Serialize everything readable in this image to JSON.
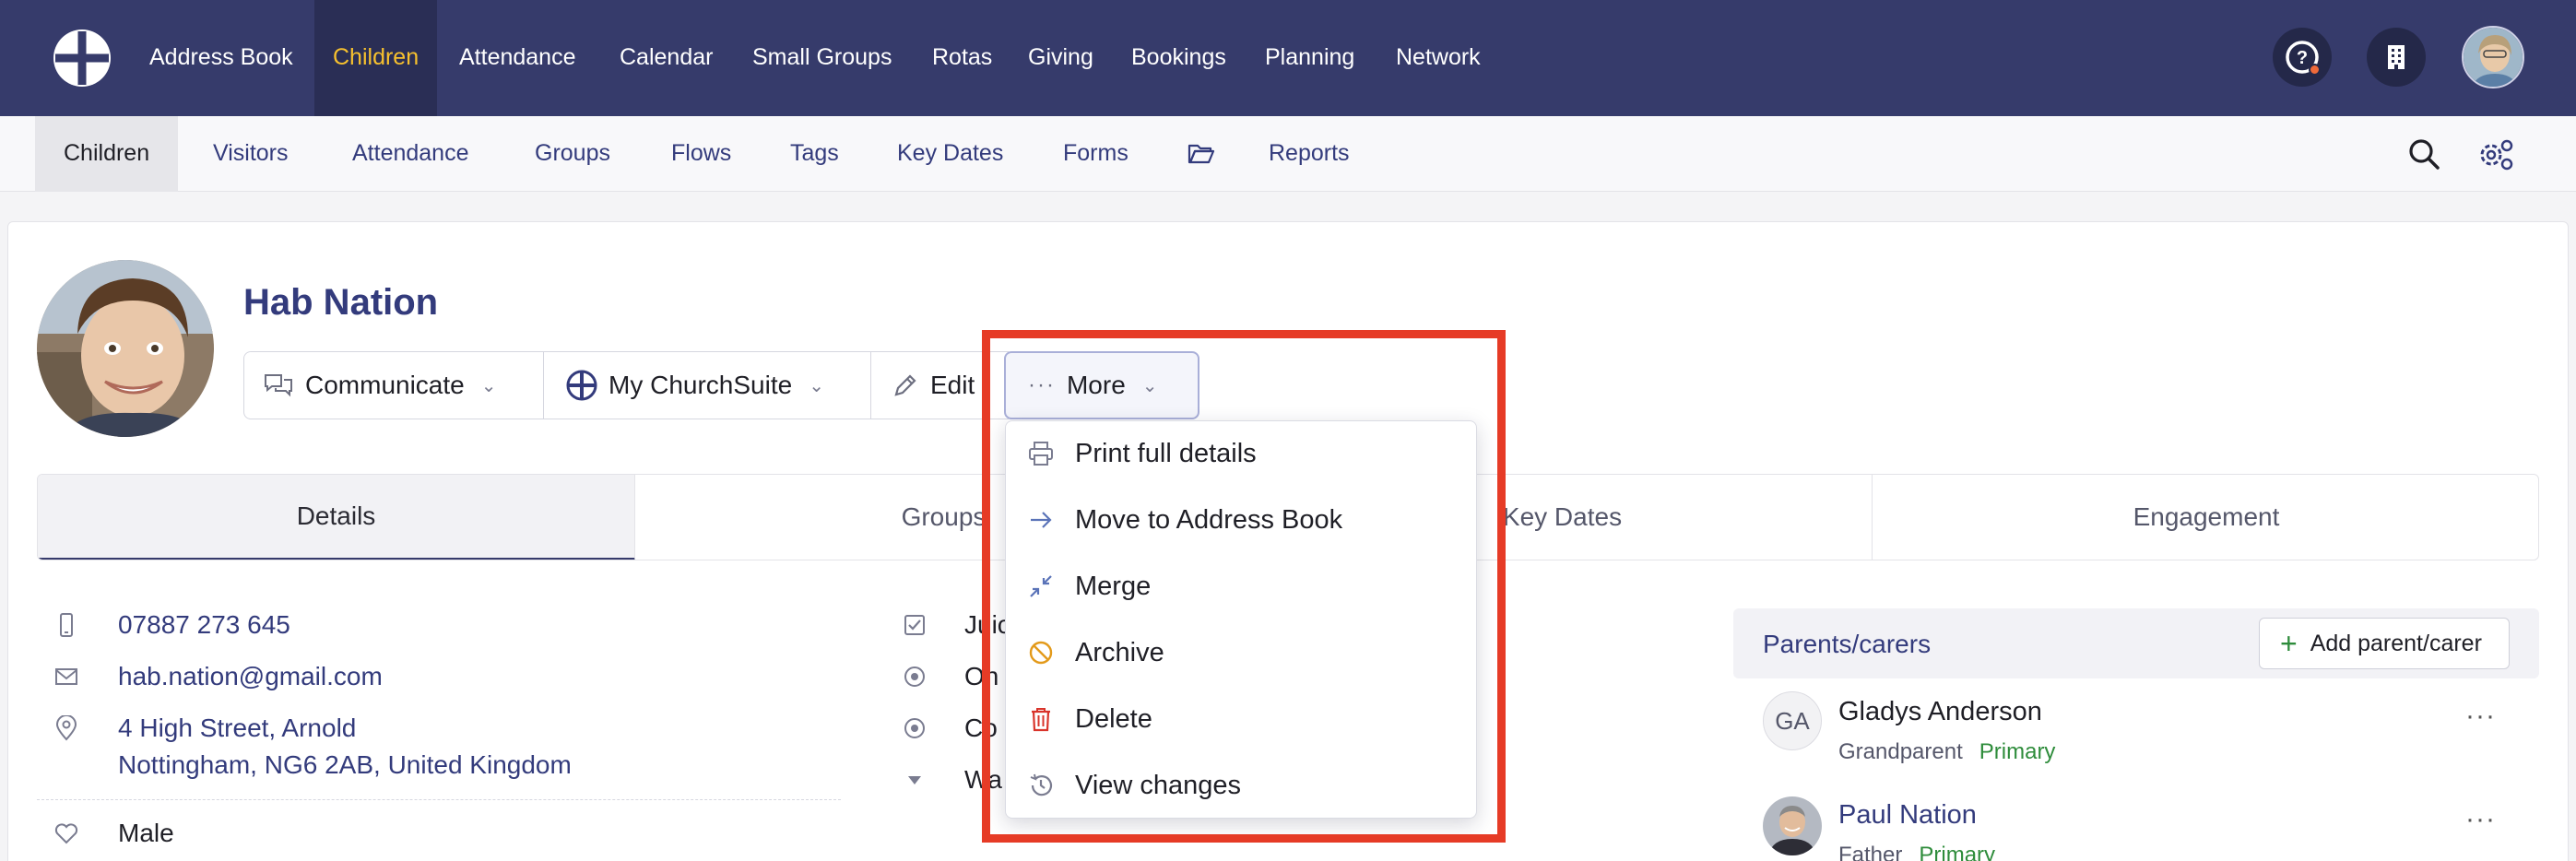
{
  "topnav": {
    "items": [
      "Address Book",
      "Children",
      "Attendance",
      "Calendar",
      "Small Groups",
      "Rotas",
      "Giving",
      "Bookings",
      "Planning",
      "Network"
    ],
    "active": "Children",
    "icons": [
      "help-icon",
      "building-icon",
      "user-avatar"
    ]
  },
  "subnav": {
    "items": [
      "Children",
      "Visitors",
      "Attendance",
      "Groups",
      "Flows",
      "Tags",
      "Key Dates",
      "Forms",
      "Reports"
    ],
    "active": "Children",
    "icons": [
      "search-icon",
      "settings-icon"
    ]
  },
  "person": {
    "name": "Hab Nation"
  },
  "actions": {
    "communicate": "Communicate",
    "my_churchsuite": "My ChurchSuite",
    "edit": "Edit",
    "more": "More"
  },
  "more_menu": {
    "items": [
      "Print full details",
      "Move to Address Book",
      "Merge",
      "Archive",
      "Delete",
      "View changes"
    ]
  },
  "tabs": [
    "Details",
    "Groups",
    "Key Dates",
    "Engagement"
  ],
  "details": {
    "phone": "07887 273 645",
    "email": "hab.nation@gmail.com",
    "address_line1": "4 High Street, Arnold",
    "address_line2": "Nottingham, NG6 2AB, United Kingdom",
    "sex": "Male"
  },
  "middle_col": [
    "Juic",
    "On",
    "Co",
    "Wa"
  ],
  "parents": {
    "title": "Parents/carers",
    "add_label": "Add parent/carer",
    "list": [
      {
        "initials": "GA",
        "name": "Gladys Anderson",
        "relation": "Grandparent",
        "primary": "Primary"
      },
      {
        "initials": "",
        "name": "Paul Nation",
        "relation": "Father",
        "primary": "Primary"
      }
    ]
  },
  "colors": {
    "nav_bg": "#363b6b",
    "nav_active_text": "#f7c12e",
    "link": "#333b7c",
    "primary_green": "#2e8c3b",
    "highlight": "#e63b26",
    "delete_red": "#d9342b",
    "archive_orange": "#e39a1a"
  }
}
